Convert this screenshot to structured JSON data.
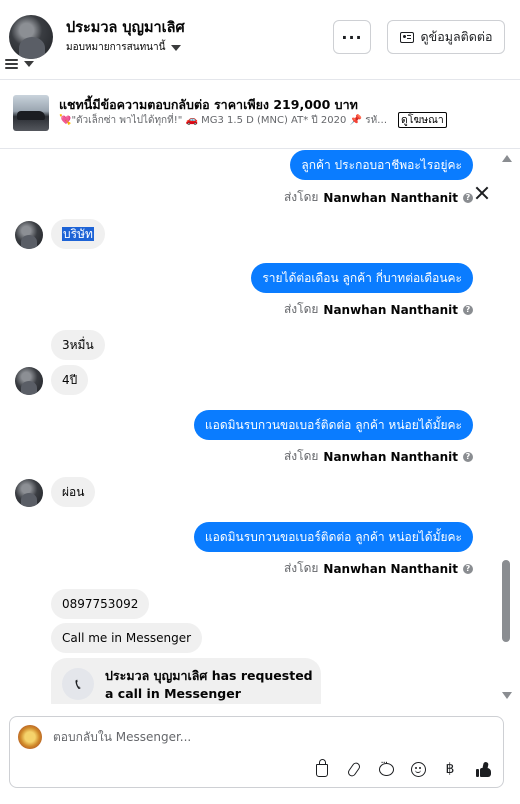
{
  "header": {
    "name": "ประมวล บุญมาเลิศ",
    "assignee": "มอบหมายการสนทนานี้",
    "more_label": "···",
    "contact_label": "ดูข้อมูลติดต่อ"
  },
  "ad": {
    "title": "แชทนี้มีข้อความตอบกลับต่อ ราคาเพียง 219,000 บาท",
    "subtitle": "💘\"ตัวเล็กซ่า พาไปได้ทุกที่!\" 🚗 MG3 1.5 D (MNC) AT* ปี 2020 📌 รหั…",
    "link_label": "ดูโฆษณา"
  },
  "messages": [
    {
      "text": "ลูกค้า ประกอบอาชีพอะไรอยู่คะ"
    },
    {
      "text": "บริษัท"
    },
    {
      "text": "รายได้ต่อเดือน ลูกค้า กี่บาทต่อเดือนคะ"
    },
    {
      "text": "3หมื่น"
    },
    {
      "text": "4ปี"
    },
    {
      "text": "แอดมินรบกวนขอเบอร์ติดต่อ ลูกค้า หน่อยได้มั้ยคะ"
    },
    {
      "text": "ผ่อน"
    },
    {
      "text": "แอดมินรบกวนขอเบอร์ติดต่อ ลูกค้า หน่อยได้มั้ยคะ"
    },
    {
      "text": "0897753092"
    },
    {
      "text": "Call me in Messenger"
    }
  ],
  "sent_by": {
    "prefix": "ส่งโดย",
    "name": "Nanwhan Nanthanit",
    "info": "?"
  },
  "call_request": {
    "text": "ประมวล บุญมาเลิศ has requested a call in Messenger"
  },
  "composer": {
    "placeholder": "ตอบกลับใน Messenger...",
    "baht_symbol": "฿"
  },
  "colors": {
    "outgoing_bubble": "#0a7cff",
    "incoming_bubble": "#f0f0f0",
    "highlight": "#1d63d6"
  }
}
